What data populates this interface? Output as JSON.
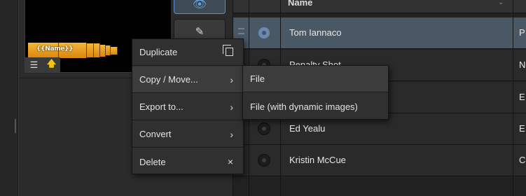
{
  "preview": {
    "thumbnail_text": "{{Name}}",
    "toolbar": {
      "list_icon": "☰",
      "up_icon": "🡅"
    }
  },
  "tools": {
    "eye_icon": "👁",
    "brush_icon": "✎"
  },
  "table": {
    "header_name": "Name",
    "header_sort_icon": "⌄",
    "rows": [
      {
        "name": "Tom Iannaco",
        "extra": "P",
        "selected": true
      },
      {
        "name": "Penalty Shot",
        "extra": "N"
      },
      {
        "name": "",
        "extra": "E"
      },
      {
        "name": "Ed Yealu",
        "extra": "E"
      },
      {
        "name": "Kristin McCue",
        "extra": "C"
      }
    ]
  },
  "context_menu": {
    "items": [
      {
        "label": "Duplicate",
        "icon": "copy-icon"
      },
      {
        "label": "Copy / Move...",
        "icon": "›"
      },
      {
        "label": "Export to...",
        "icon": "›"
      },
      {
        "label": "Convert",
        "icon": "›"
      },
      {
        "label": "Delete",
        "icon": "×"
      }
    ]
  },
  "submenu": {
    "items": [
      {
        "label": "File"
      },
      {
        "label": "File (with dynamic images)"
      }
    ]
  }
}
